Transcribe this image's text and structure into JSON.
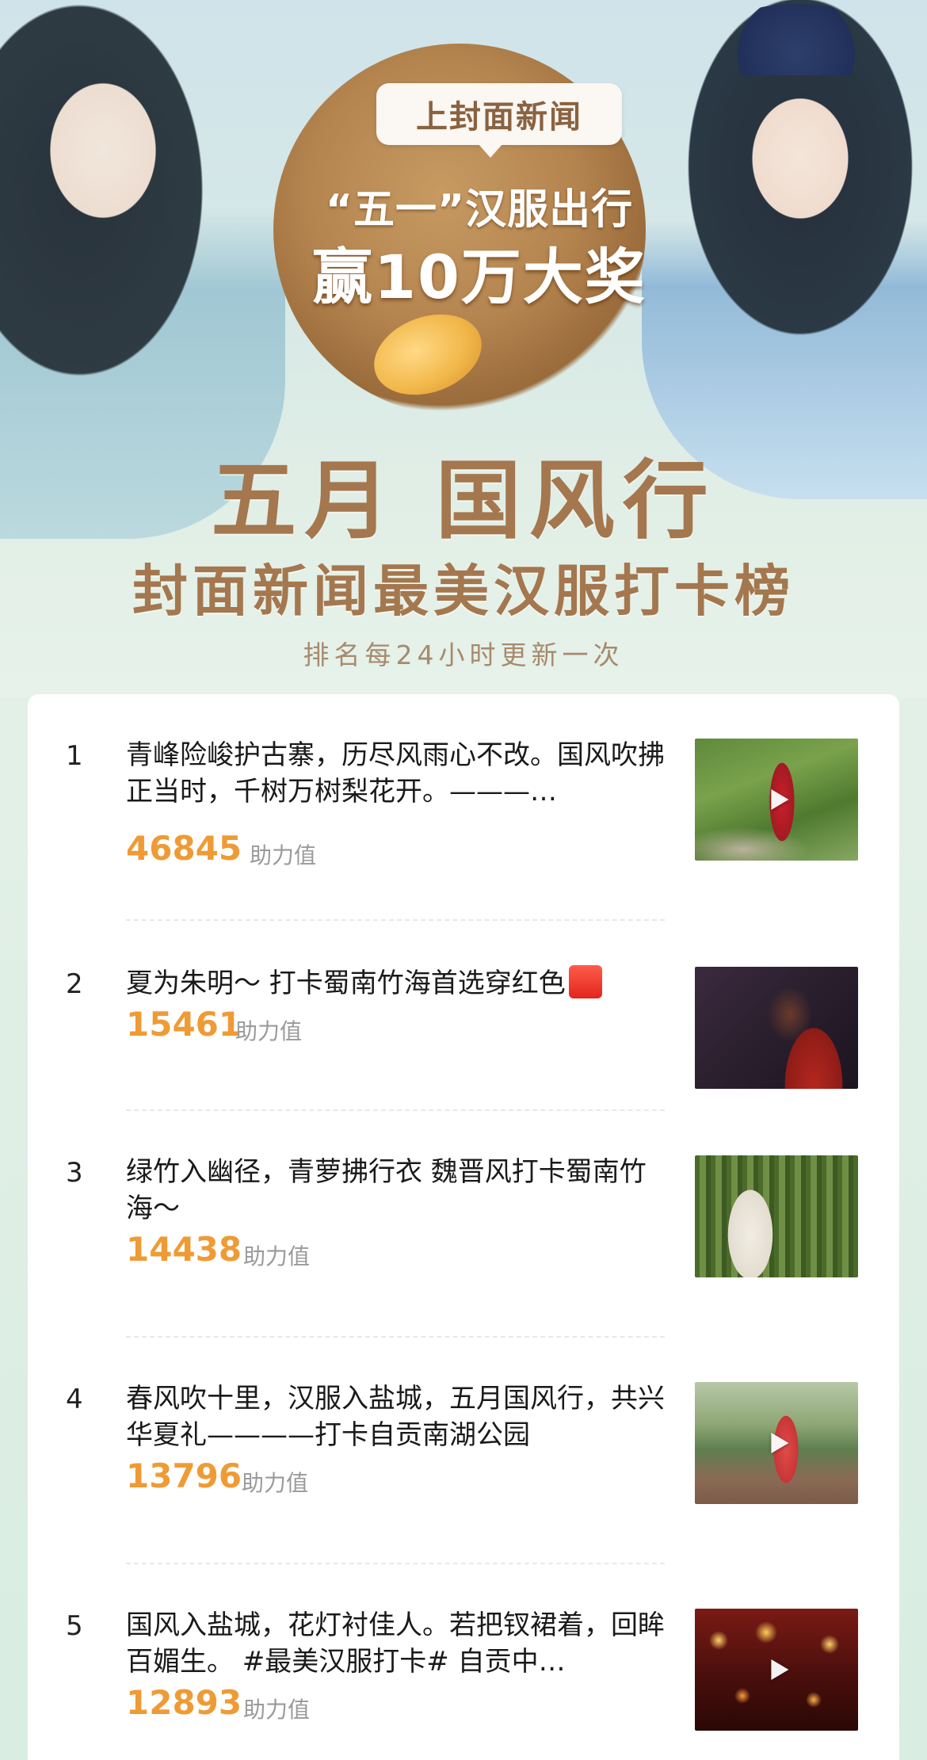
{
  "banner": {
    "bubble_text": "上封面新闻",
    "promo_line1": "“五一”汉服出行",
    "promo_line2": "赢10万大奖",
    "title_main": "五月 国风行",
    "title_sub": "封面新闻最美汉服打卡榜",
    "update_note": "排名每24小时更新一次"
  },
  "list": {
    "score_label": "助力值",
    "items": [
      {
        "rank": "1",
        "title": "青峰险峻护古寨，历尽风雨心不改。国风吹拂正当时，千树万树梨花开。———…",
        "score": "46845",
        "has_video": true,
        "thumb_icon": "play-icon"
      },
      {
        "rank": "2",
        "title": "夏为朱明～ 打卡蜀南竹海首选穿红色",
        "title_emoji": "red-square-emoji",
        "score": "15461",
        "has_video": false
      },
      {
        "rank": "3",
        "title": "绿竹入幽径，青萝拂行衣 魏晋风打卡蜀南竹海～",
        "score": "14438",
        "has_video": false
      },
      {
        "rank": "4",
        "title": "春风吹十里，汉服入盐城，五月国风行，共兴华夏礼————打卡自贡南湖公园",
        "score": "13796",
        "has_video": true,
        "thumb_icon": "play-icon"
      },
      {
        "rank": "5",
        "title": "国风入盐城，花灯衬佳人。若把钗裙着，回眸百媚生。 #最美汉服打卡# 自贡中…",
        "score": "12893",
        "has_video": true,
        "thumb_icon": "play-icon"
      }
    ]
  },
  "colors": {
    "score": "#ef9b35",
    "title_brown": "#a4774e",
    "background": "#e3f0e8"
  }
}
